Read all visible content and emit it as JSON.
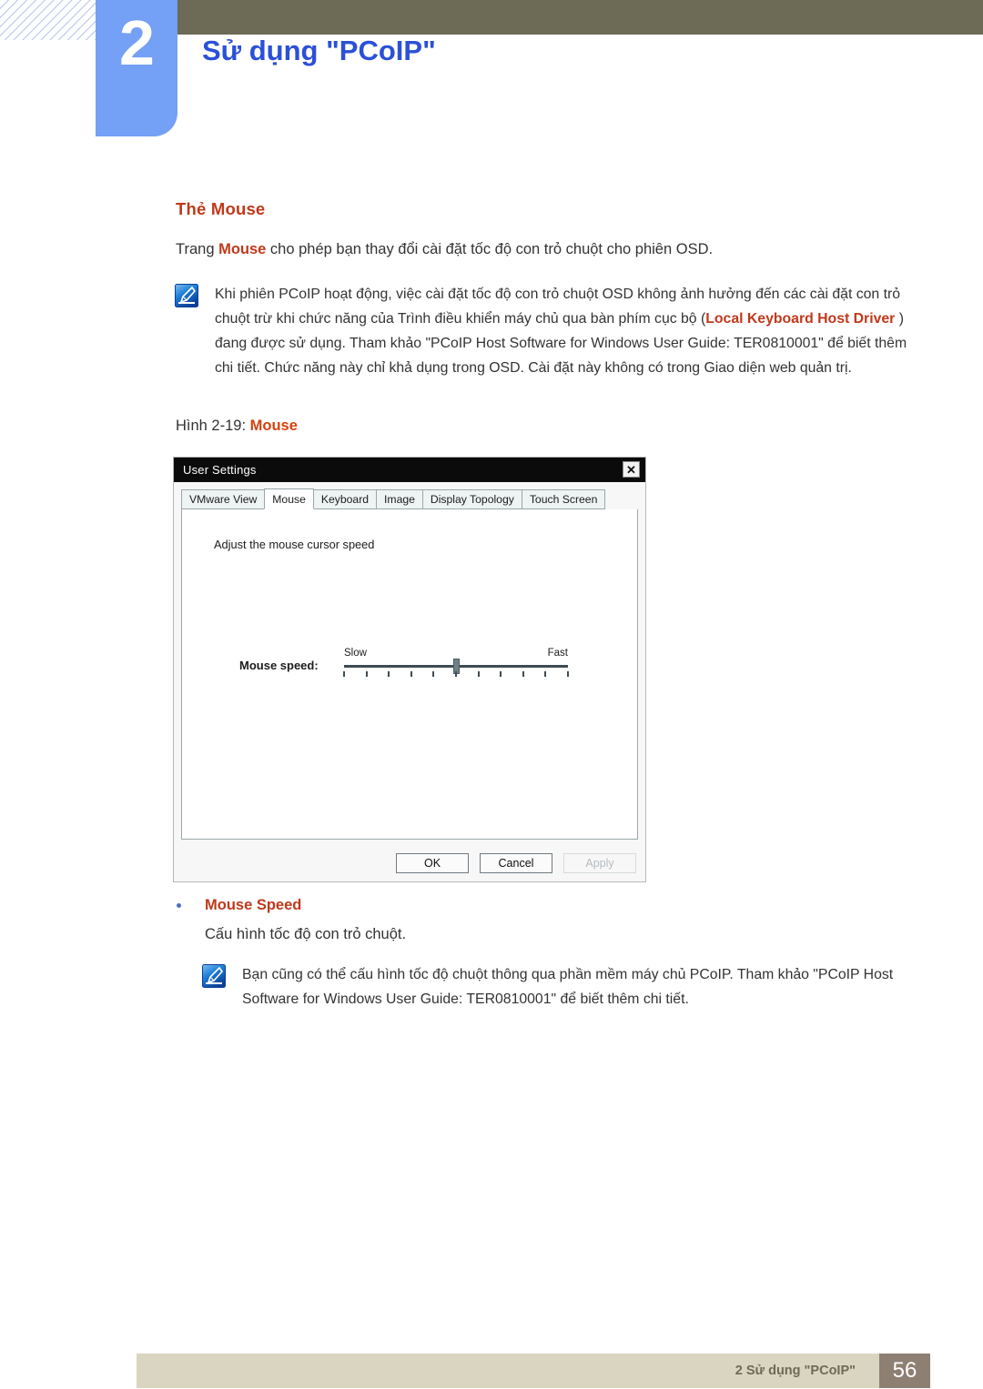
{
  "header": {
    "chapter_number": "2",
    "chapter_title": "Sử dụng \"PCoIP\"",
    "accent_blue": "#2b50d8",
    "tab_blue": "#74a0f5",
    "olive": "#6d6a55"
  },
  "section": {
    "heading": "Thẻ Mouse",
    "intro_prefix": "Trang ",
    "intro_highlight": "Mouse",
    "intro_suffix": " cho phép bạn thay đổi cài đặt tốc độ con trỏ chuột cho phiên OSD.",
    "heading_color": "#c0391b"
  },
  "note_1": {
    "icon": "note-pen-icon",
    "part1": "Khi phiên PCoIP hoạt động, việc cài đặt tốc độ con trỏ chuột OSD không ảnh hưởng đến các cài đặt con trỏ chuột trừ khi chức năng của Trình điều khiển máy chủ qua bàn phím cục bộ (",
    "highlight": "Local Keyboard Host Driver",
    "part2": " ) đang được sử dụng. Tham khảo \"PCoIP Host Software for Windows User Guide: TER0810001\" để biết thêm chi tiết. Chức năng này chỉ khả dụng trong OSD. Cài đặt này không có trong Giao diện web quản trị."
  },
  "figure": {
    "caption_prefix": "Hình 2-19: ",
    "caption_highlight": "Mouse"
  },
  "dialog": {
    "title": "User Settings",
    "close_label": "✕",
    "tabs": [
      {
        "label": "VMware View",
        "active": false
      },
      {
        "label": "Mouse",
        "active": true
      },
      {
        "label": "Keyboard",
        "active": false
      },
      {
        "label": "Image",
        "active": false
      },
      {
        "label": "Display Topology",
        "active": false
      },
      {
        "label": "Touch Screen",
        "active": false
      }
    ],
    "panel_heading": "Adjust the mouse cursor speed",
    "speed_label": "Mouse speed:",
    "slider": {
      "min_label": "Slow",
      "max_label": "Fast",
      "ticks": 11,
      "value_index": 5
    },
    "buttons": [
      {
        "label": "OK",
        "disabled": false
      },
      {
        "label": "Cancel",
        "disabled": false
      },
      {
        "label": "Apply",
        "disabled": true
      }
    ]
  },
  "bullet": {
    "label": "Mouse Speed",
    "description": "Cấu hình tốc độ con trỏ chuột."
  },
  "note_2": {
    "icon": "note-pen-icon",
    "text": "Bạn cũng có thể cấu hình tốc độ chuột thông qua phần mềm máy chủ PCoIP. Tham khảo \"PCoIP Host Software for Windows User Guide: TER0810001\" để biết thêm chi tiết."
  },
  "footer": {
    "text": "2 Sử dụng \"PCoIP\"",
    "page_number": "56",
    "bar_color": "#d9d5c1",
    "page_box_color": "#8e7f73"
  }
}
